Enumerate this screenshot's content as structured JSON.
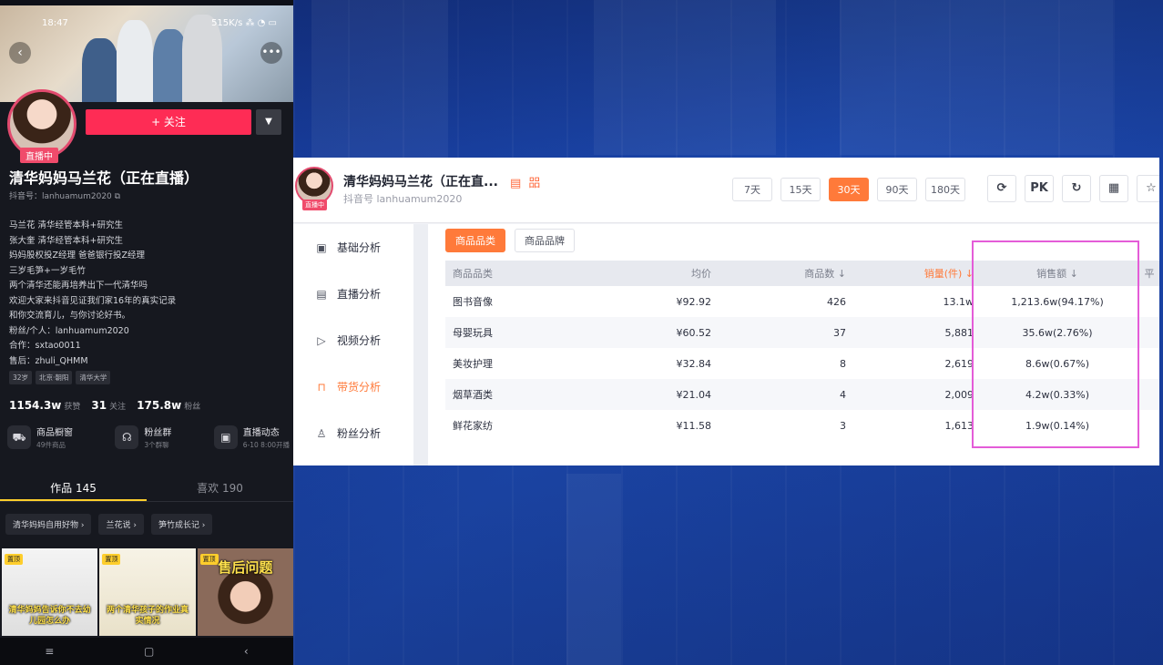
{
  "phone": {
    "status_time": "18:47",
    "status_net": "515K/s  ⁂ ◔ ▭",
    "follow_label": "+ 关注",
    "live_tag": "直播中",
    "name": "清华妈妈马兰花（正在直播）",
    "douyin_id": "抖音号：lanhuamum2020",
    "bio": [
      "马兰花 清华经管本科+研究生",
      "张大奎 清华经管本科+研究生",
      "妈妈股权投Z经理 爸爸银行投Z经理",
      "三岁毛笋+一岁毛竹",
      "两个清华还能再培养出下一代清华吗",
      "欢迎大家来抖音见证我们家16年的真实记录",
      "和你交流育儿，与你讨论好书。",
      "粉丝/个人：lanhuamum2020",
      "合作：sxtao0011",
      "售后：zhuli_QHMM"
    ],
    "tags": [
      "32岁",
      "北京·朝阳",
      "清华大学"
    ],
    "stats": [
      {
        "value": "1154.3w",
        "label": "获赞"
      },
      {
        "value": "31",
        "label": "关注"
      },
      {
        "value": "175.8w",
        "label": "粉丝"
      }
    ],
    "shortcuts": [
      {
        "title": "商品橱窗",
        "sub": "49件商品"
      },
      {
        "title": "粉丝群",
        "sub": "3个群聊"
      },
      {
        "title": "直播动态",
        "sub": "6-10 8:00开播"
      }
    ],
    "tabs": [
      "作品 145",
      "喜欢 190"
    ],
    "collections": [
      "清华妈妈自用好物 ›",
      "兰花说 ›",
      "笋竹成长记 ›"
    ],
    "thumbs": [
      {
        "tag": "置顶",
        "caption": "清华妈妈告诉你不去幼儿园怎么办"
      },
      {
        "tag": "置顶",
        "caption": "两个清华孩子的作业真实情况"
      },
      {
        "tag": "置顶",
        "caption": "售后问题"
      }
    ],
    "nav": [
      "≡",
      "▢",
      "‹"
    ]
  },
  "dashboard": {
    "name": "清华妈妈马兰花（正在直...",
    "badge": "▤ 㗊",
    "douyin_id": "抖音号 lanhuamum2020",
    "live_tag": "直播中",
    "periods": [
      "7天",
      "15天",
      "30天",
      "90天",
      "180天"
    ],
    "active_period": "30天",
    "tools": [
      "⟳",
      "PK",
      "↻",
      "▦",
      "☆"
    ],
    "sidebar": [
      {
        "icon": "▣",
        "label": "基础分析"
      },
      {
        "icon": "▤",
        "label": "直播分析"
      },
      {
        "icon": "▷",
        "label": "视频分析"
      },
      {
        "icon": "⊓",
        "label": "带货分析"
      },
      {
        "icon": "♙",
        "label": "粉丝分析"
      }
    ],
    "subtabs": [
      "商品品类",
      "商品品牌"
    ],
    "table": {
      "headers": [
        "商品品类",
        "均价",
        "商品数 ↓",
        "销量(件) ↓",
        "销售额 ↓",
        "平"
      ],
      "rows": [
        [
          "图书音像",
          "¥92.92",
          "426",
          "13.1w",
          "1,213.6w(94.17%)"
        ],
        [
          "母婴玩具",
          "¥60.52",
          "37",
          "5,881",
          "35.6w(2.76%)"
        ],
        [
          "美妆护理",
          "¥32.84",
          "8",
          "2,619",
          "8.6w(0.67%)"
        ],
        [
          "烟草酒类",
          "¥21.04",
          "4",
          "2,009",
          "4.2w(0.33%)"
        ],
        [
          "鲜花家纺",
          "¥11.58",
          "3",
          "1,613",
          "1.9w(0.14%)"
        ]
      ]
    }
  },
  "colors": {
    "accent": "#ff7a3a",
    "follow": "#fe2c55",
    "highlight": "#e45cd8",
    "background": "#1a3a8c"
  }
}
